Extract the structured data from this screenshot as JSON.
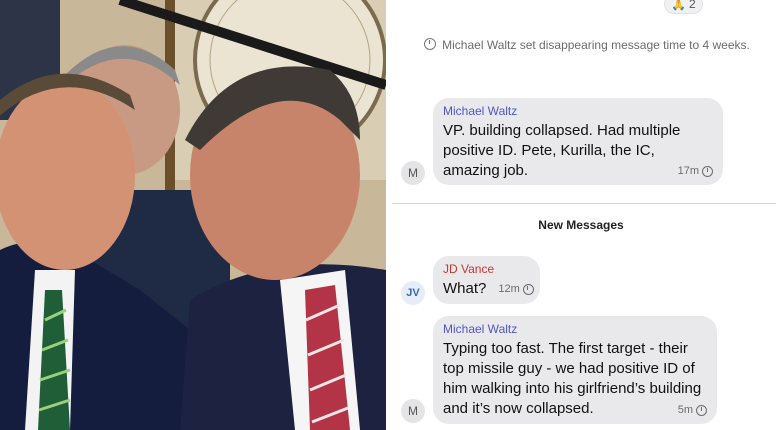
{
  "photo": {
    "description_icon": "photo"
  },
  "reaction": {
    "emoji": "🙏",
    "count": "2"
  },
  "system_message": {
    "icon": "timer-icon",
    "text": "Michael Waltz set disappearing message time to 4 weeks."
  },
  "messages": [
    {
      "sender": "Michael Waltz",
      "avatar": "M",
      "text": "VP.  building collapsed. Had multiple positive ID. Pete, Kurilla, the IC, amazing job.",
      "time": "17m"
    },
    {
      "sender": "JD Vance",
      "avatar": "JV",
      "text": "What?",
      "time": "12m"
    },
    {
      "sender": "Michael Waltz",
      "avatar": "M",
      "text": "Typing too fast. The first target - their top missile guy - we had positive ID of him walking into his girlfriend’s building and it’s now collapsed.",
      "time": "5m"
    }
  ],
  "new_messages_label": "New Messages",
  "colors": {
    "sender_waltz": "#4f56c7",
    "sender_vance": "#c43a2f",
    "bubble": "#e9e9eb"
  }
}
